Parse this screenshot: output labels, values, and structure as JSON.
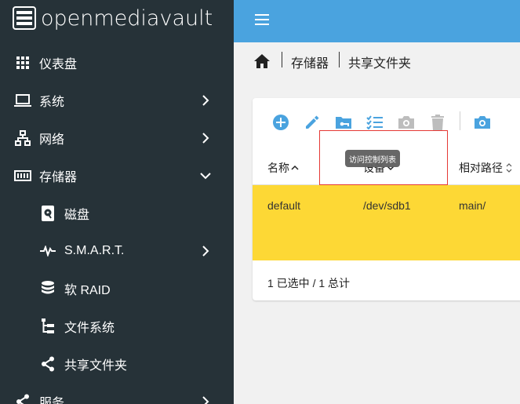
{
  "app": {
    "brand": "openmediavault"
  },
  "sidebar": {
    "items": [
      {
        "label": "仪表盘",
        "icon": "grid-icon"
      },
      {
        "label": "系统",
        "icon": "laptop-icon"
      },
      {
        "label": "网络",
        "icon": "network-icon"
      },
      {
        "label": "存储器",
        "icon": "storage-icon"
      },
      {
        "label": "磁盘",
        "icon": "disk-icon"
      },
      {
        "label": "S.M.A.R.T.",
        "icon": "pulse-icon"
      },
      {
        "label": "软 RAID",
        "icon": "database-icon"
      },
      {
        "label": "文件系统",
        "icon": "file-tree-icon"
      },
      {
        "label": "共享文件夹",
        "icon": "share-icon"
      },
      {
        "label": "服务",
        "icon": "share-icon"
      }
    ]
  },
  "breadcrumb": {
    "items": [
      "存储器",
      "共享文件夹"
    ]
  },
  "toolbar": {
    "tooltip": "访问控制列表",
    "buttons": [
      "add-icon",
      "edit-icon",
      "folder-key-icon",
      "checklist-icon",
      "camera-icon",
      "delete-icon",
      "snapshot-icon"
    ]
  },
  "table": {
    "columns": [
      "名称",
      "设备",
      "相对路径"
    ],
    "rows": [
      {
        "name": "default",
        "device": "/dev/sdb1",
        "path": "main/"
      }
    ],
    "footer": "1 已选中 / 1 总计"
  },
  "colors": {
    "sidebar": "#263238",
    "topbar": "#4aa3df",
    "selected_row": "#fdd835",
    "accent": "#4aa3df"
  }
}
